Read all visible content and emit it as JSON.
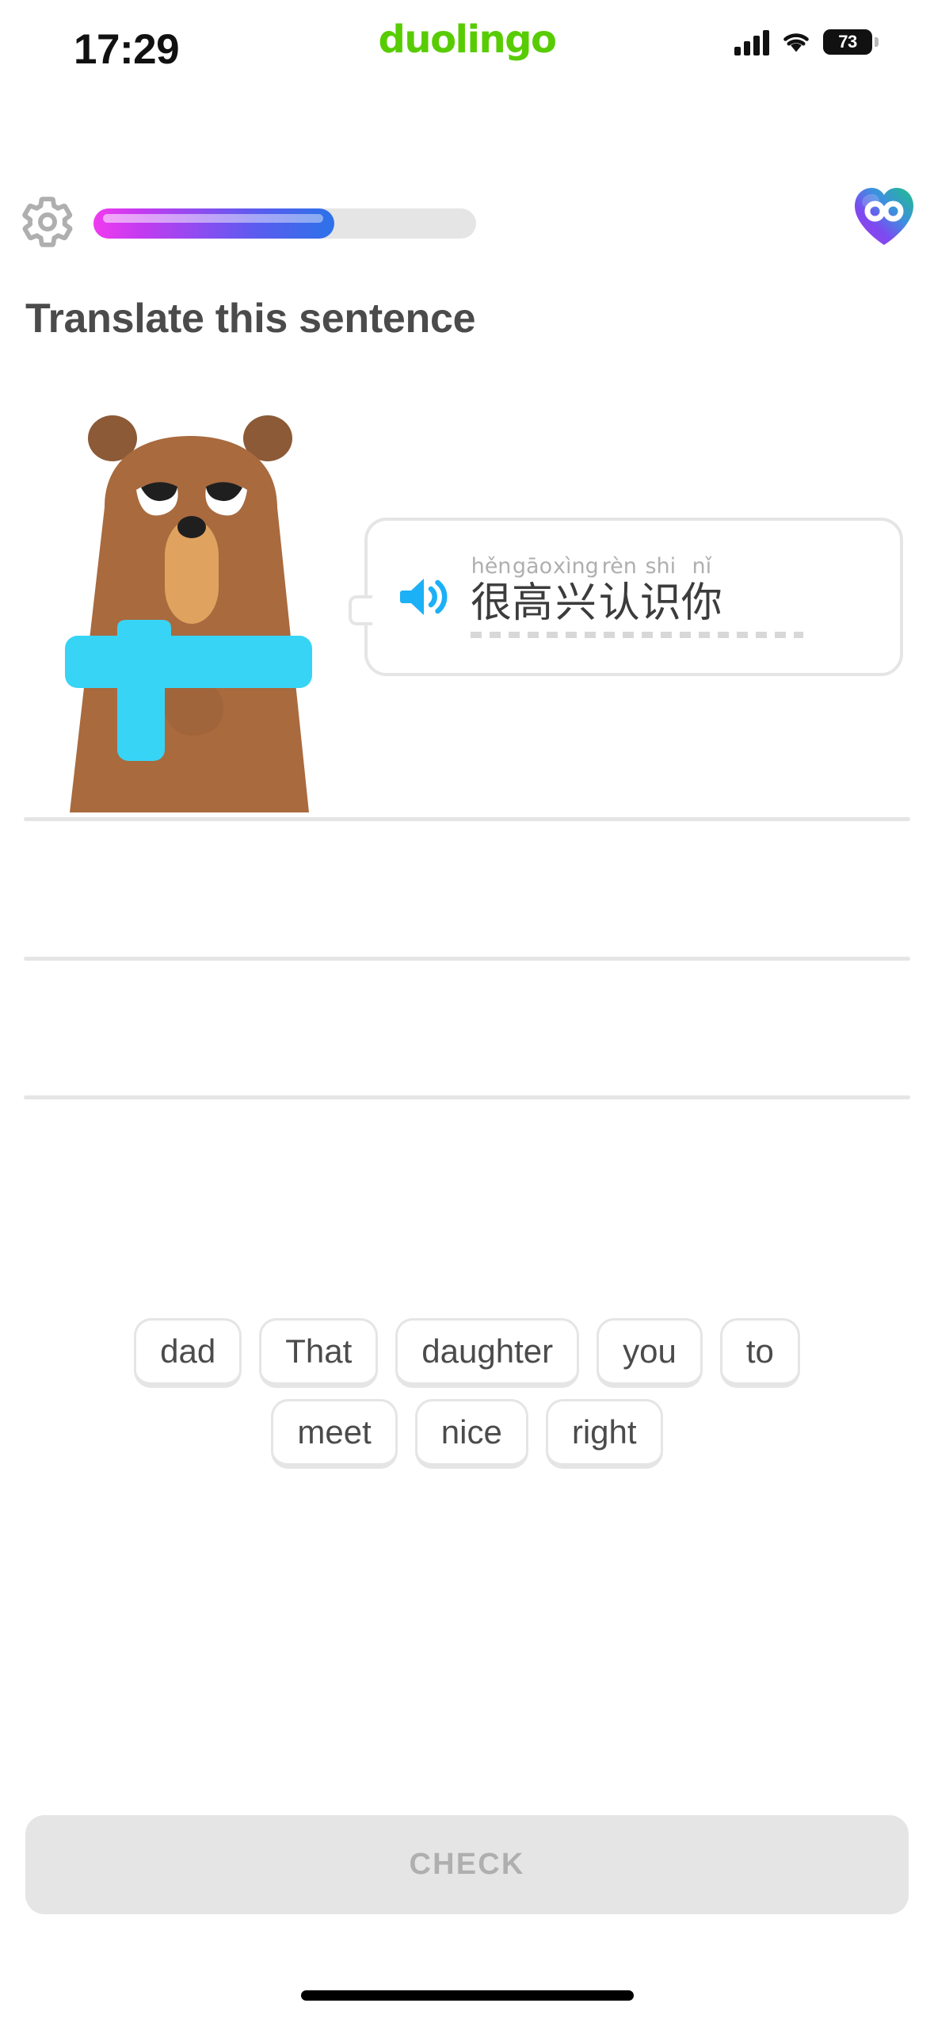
{
  "status_bar": {
    "time": "17:29",
    "app_logo": "duolingo",
    "battery_percent": "73",
    "signal_icon": "cellular-signal-icon",
    "wifi_icon": "wifi-icon",
    "battery_icon": "battery-icon"
  },
  "top_bar": {
    "settings_icon": "gear-icon",
    "progress_percent": 63,
    "hearts_icon": "heart-infinity-icon",
    "hearts_value": "∞",
    "progress_gradient_start": "#F03BF0",
    "progress_gradient_end": "#2C72E8",
    "progress_track_color": "#E5E5E5"
  },
  "exercise": {
    "prompt": "Translate this sentence",
    "character_icon": "bear-character-icon",
    "speaker_icon": "speaker-icon",
    "speaker_color": "#1CB0F6",
    "sentence_characters": [
      {
        "pinyin": "hěn",
        "hanzi": "很"
      },
      {
        "pinyin": "gāo",
        "hanzi": "高"
      },
      {
        "pinyin": "xìng",
        "hanzi": "兴"
      },
      {
        "pinyin": "rèn",
        "hanzi": "认"
      },
      {
        "pinyin": "shi",
        "hanzi": "识"
      },
      {
        "pinyin": "nǐ",
        "hanzi": "你"
      }
    ],
    "sentence_pinyin": "hěn gāo xìng rèn shi nǐ",
    "sentence_hanzi": "很高兴认识你",
    "answer_lines": 3
  },
  "word_bank": {
    "rows": [
      [
        "dad",
        "That",
        "daughter",
        "you",
        "to"
      ],
      [
        "meet",
        "nice",
        "right"
      ]
    ]
  },
  "footer": {
    "check_label": "CHECK",
    "check_enabled": false
  }
}
